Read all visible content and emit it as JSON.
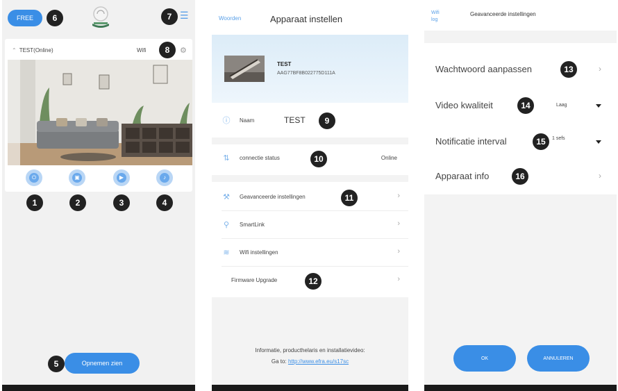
{
  "panel1": {
    "pill_label": "FREE",
    "device_label": "TEST(Online)",
    "wifi_label": "Wifi",
    "start_button_label": "Opnemen zien",
    "badges": {
      "b6": "6",
      "b7": "7",
      "b8": "8",
      "b1": "1",
      "b2": "2",
      "b3": "3",
      "b4": "4",
      "b5": "5"
    }
  },
  "panel2": {
    "back_label": "Woorden",
    "title": "Apparaat instellen",
    "device_name": "TEST",
    "device_uid": "AAG77BF8B022775D111A",
    "name_label": "Naam",
    "name_value": "TEST",
    "connection_label": "connectie status",
    "connection_value": "Online",
    "menu": {
      "advanced": "Geavanceerde instellingen",
      "smartlink": "SmartLink",
      "wifi": "Wifi instellingen",
      "firmware": "Firmware Upgrade"
    },
    "footer_line1": "Informatie, producthelaris en installatievideo:",
    "footer_prefix": "Ga to:",
    "footer_link": "http://www.efra.eu/s17sc",
    "badges": {
      "b9": "9",
      "b10": "10",
      "b11": "11",
      "b12": "12"
    }
  },
  "panel3": {
    "back_label": "Wifi\nlog",
    "title": "Geavanceerde instellingen",
    "rows": {
      "password": "Wachtwoord aanpassen",
      "video_quality": "Video kwaliteit",
      "video_quality_value": "Laag",
      "notify_interval": "Notificatie interval",
      "notify_interval_value": "1 sefs",
      "device_info": "Apparaat info"
    },
    "ok_label": "OK",
    "cancel_label": "ANNULEREN",
    "badges": {
      "b13": "13",
      "b14": "14",
      "b15": "15",
      "b16": "16"
    }
  },
  "colors": {
    "accent": "#3a8ee6",
    "badge": "#222222",
    "panel_gray": "#f3f3f3",
    "hero_blue": "#dcecf8"
  }
}
